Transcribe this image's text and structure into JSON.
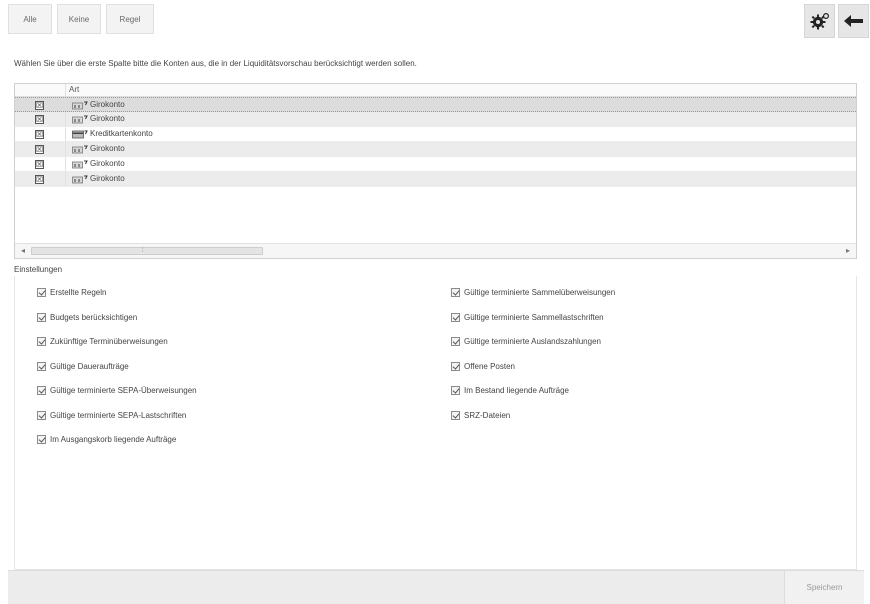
{
  "toolbar": {
    "alle_label": "Alle",
    "keine_label": "Keine",
    "regel_label": "Regel",
    "settings_icon": "gear-plus-icon",
    "back_icon": "arrow-left-icon"
  },
  "intro_text": "Wählen Sie über die erste Spalte bitte die Konten aus, die in der Liquiditätsvorschau berücksichtigt werden sollen.",
  "grid": {
    "header_art": "Art",
    "rows": [
      {
        "checked": "☒",
        "label": "Girokonto",
        "icon": "bank-account-icon"
      },
      {
        "checked": "☒",
        "label": "Girokonto",
        "icon": "bank-account-icon"
      },
      {
        "checked": "☒",
        "label": "Kreditkartenkonto",
        "icon": "credit-card-account-icon"
      },
      {
        "checked": "☒",
        "label": "Girokonto",
        "icon": "bank-account-icon"
      },
      {
        "checked": "☒",
        "label": "Girokonto",
        "icon": "bank-account-icon"
      },
      {
        "checked": "☒",
        "label": "Girokonto",
        "icon": "bank-account-icon"
      }
    ],
    "scroll_left": "◂",
    "scroll_right": "▸",
    "scroll_grip": "⦙"
  },
  "settings": {
    "label": "Einstellungen",
    "left": [
      "Erstellte Regeln",
      "Budgets berücksichtigen",
      "Zukünftige Terminüberweisungen",
      "Gültige Daueraufträge",
      "Gültige terminierte SEPA-Überweisungen",
      "Gültige terminierte SEPA-Lastschriften",
      "Im Ausgangskorb liegende Aufträge"
    ],
    "right": [
      "Gültige terminierte Sammelüberweisungen",
      "Gültige terminierte Sammellastschriften",
      "Gültige terminierte Auslandszahlungen",
      "Offene Posten",
      "Im Bestand liegende Aufträge",
      "SRZ-Dateien"
    ]
  },
  "footer": {
    "save_label": "Speichern"
  }
}
